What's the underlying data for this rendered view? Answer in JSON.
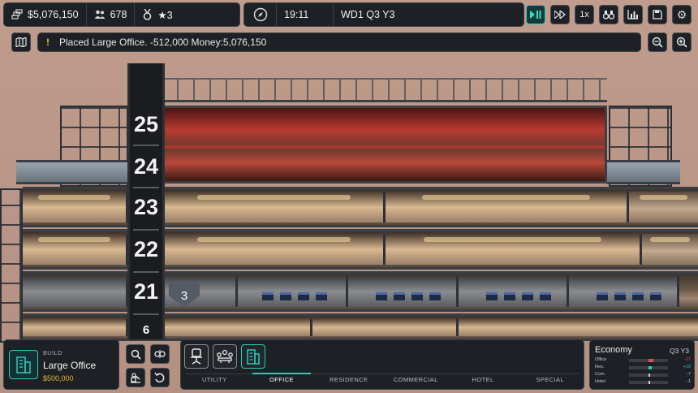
{
  "stats": {
    "money": "$5,076,150",
    "population": "678",
    "rating": "★3"
  },
  "time": {
    "clock": "19:11",
    "date": "WD1 Q3 Y3"
  },
  "controls": {
    "speed_label": "1x"
  },
  "message": {
    "warning_symbol": "!",
    "text": "Placed Large Office. -512,000 Money:5,076,150"
  },
  "building": {
    "floors": [
      "25",
      "24",
      "23",
      "22",
      "21"
    ],
    "floor_marker": "3",
    "lower_tag": "6"
  },
  "build": {
    "label": "BUILD",
    "name": "Large Office",
    "price": "$500,000"
  },
  "categories": {
    "tabs": [
      "UTILITY",
      "OFFICE",
      "RESIDENCE",
      "COMMERCIAL",
      "HOTEL",
      "SPECIAL"
    ],
    "active_tab": "OFFICE"
  },
  "economy": {
    "title": "Economy",
    "period": "Q3 Y3",
    "rows": [
      {
        "label": "Office",
        "value": "-27",
        "color": "#e05050",
        "level": 0.62
      },
      {
        "label": "Res.",
        "value": "+19",
        "color": "#30c8b8",
        "level": 0.58
      },
      {
        "label": "Com.",
        "value": "-7",
        "color": "#c8ccd0",
        "level": 0.5
      },
      {
        "label": "Hotel",
        "value": "-1",
        "color": "#c8ccd0",
        "level": 0.5
      }
    ]
  },
  "colors": {
    "accent": "#30c8b8",
    "money": "#e8b830",
    "negative": "#e05050"
  }
}
